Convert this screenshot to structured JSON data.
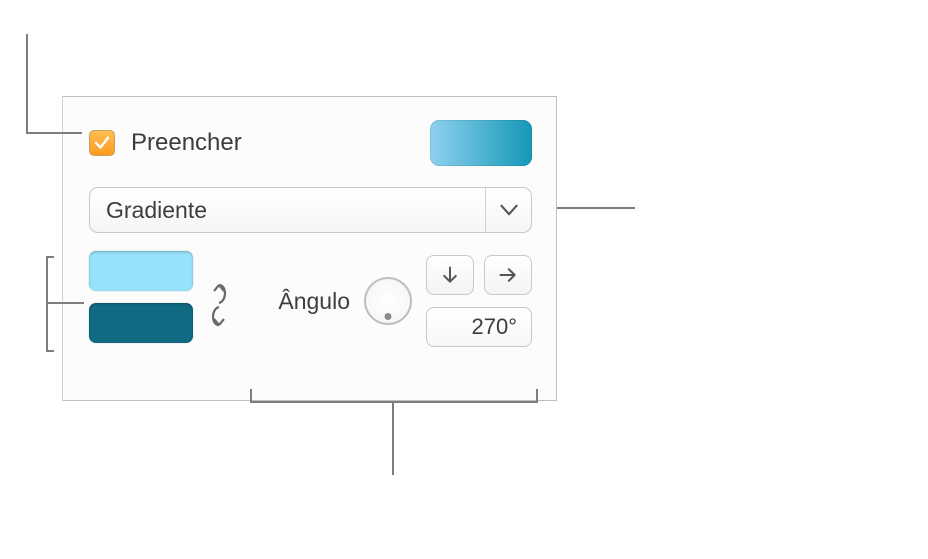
{
  "fill": {
    "checkbox_label": "Preencher",
    "checked": true,
    "preview_gradient_start": "#8dd1ed",
    "preview_gradient_end": "#1597b8"
  },
  "fill_type": {
    "selected": "Gradiente"
  },
  "gradient": {
    "color1": "#96e2fa",
    "color2": "#0f6a82",
    "angle_label": "Ângulo",
    "angle_value": "270°"
  },
  "icons": {
    "checkbox": "check-icon",
    "dropdown": "chevron-down-icon",
    "swap": "swap-vertical-icon",
    "dial": "angle-dial",
    "arrow_down": "arrow-down-icon",
    "arrow_right": "arrow-right-icon"
  }
}
